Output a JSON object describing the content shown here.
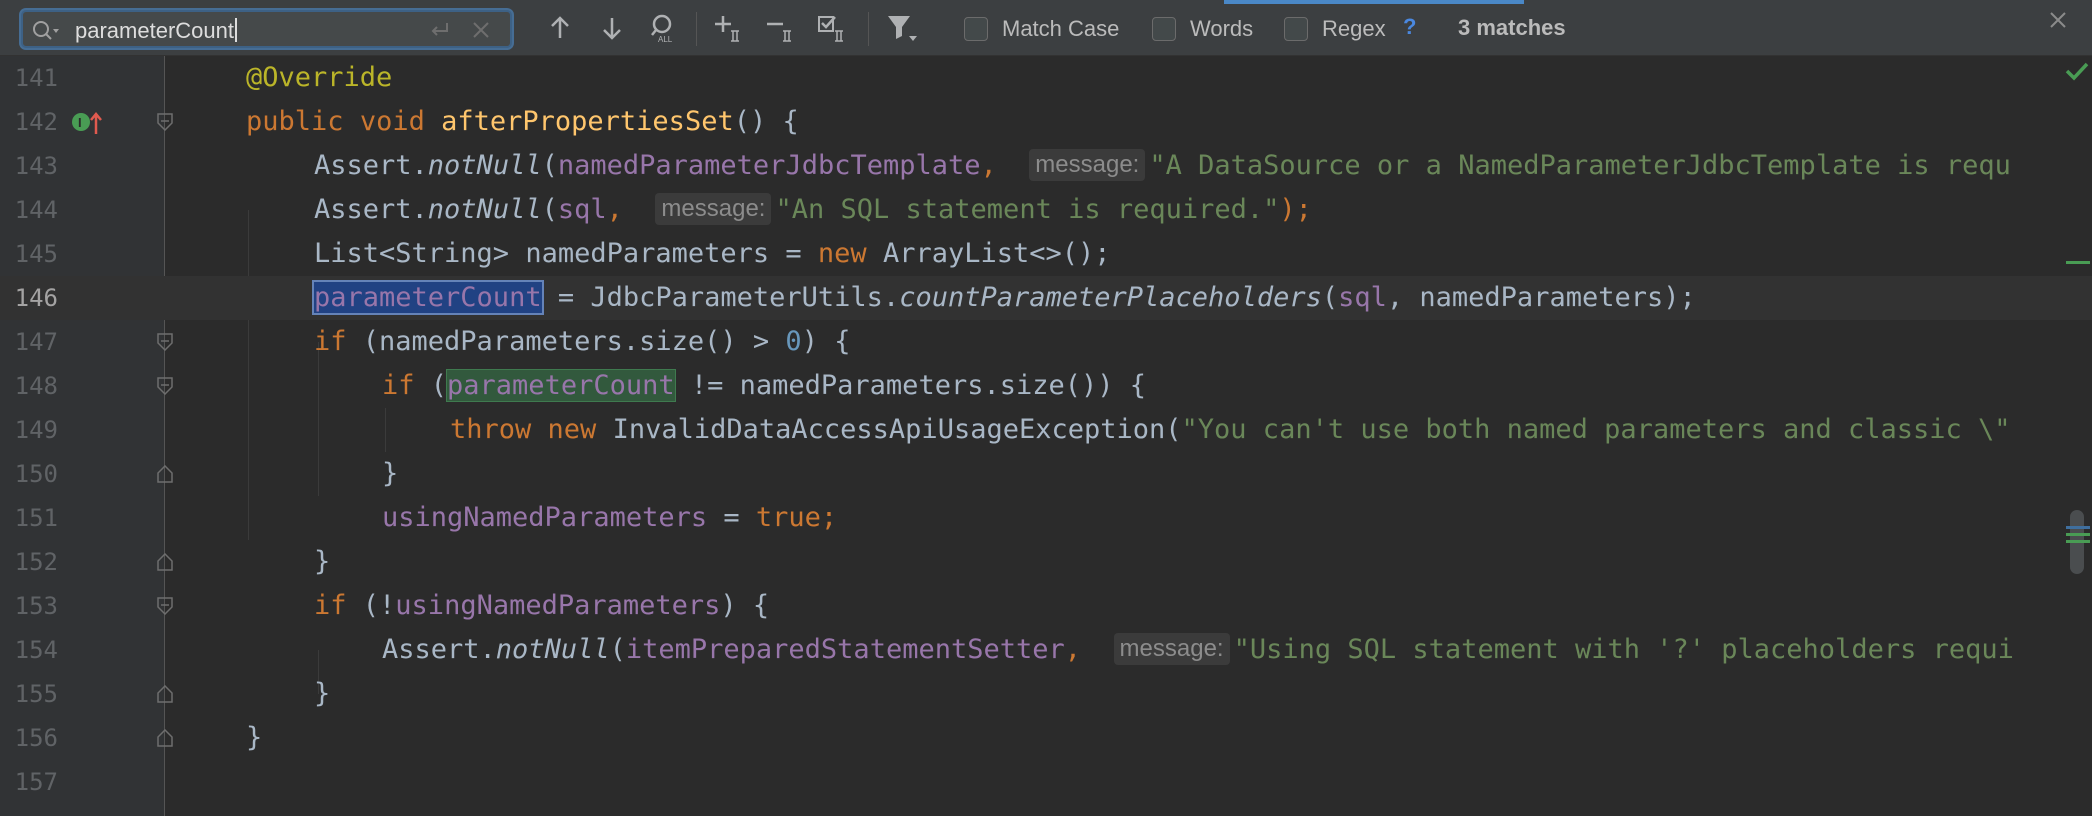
{
  "find": {
    "query": "parameterCount",
    "options": {
      "match_case": "Match Case",
      "words": "Words",
      "regex": "Regex",
      "help": "?"
    },
    "match_count": "3 matches"
  },
  "editor": {
    "lines": [
      {
        "n": "141"
      },
      {
        "n": "142"
      },
      {
        "n": "143"
      },
      {
        "n": "144"
      },
      {
        "n": "145"
      },
      {
        "n": "146"
      },
      {
        "n": "147"
      },
      {
        "n": "148"
      },
      {
        "n": "149"
      },
      {
        "n": "150"
      },
      {
        "n": "151"
      },
      {
        "n": "152"
      },
      {
        "n": "153"
      },
      {
        "n": "154"
      },
      {
        "n": "155"
      },
      {
        "n": "156"
      },
      {
        "n": "157"
      }
    ],
    "tokens": {
      "l141": {
        "annotation": "@Override"
      },
      "l142": {
        "kw1": "public",
        "kw2": "void",
        "fn": "afterPropertiesSet",
        "rest": "() {"
      },
      "l143": {
        "cls": "Assert.",
        "method": "notNull",
        "open": "(",
        "field": "namedParameterJdbcTemplate",
        "comma": ",",
        "hint": "message:",
        "str": "\"A DataSource or a NamedParameterJdbcTemplate is requ"
      },
      "l144": {
        "cls": "Assert.",
        "method": "notNull",
        "open": "(",
        "field": "sql",
        "comma": ",",
        "hint": "message:",
        "str": "\"An SQL statement is required.\"",
        "close": ");"
      },
      "l145": {
        "pre": "List<String> namedParameters = ",
        "kw": "new",
        "post": " ArrayList<>();"
      },
      "l146": {
        "match": "parameterCount",
        "mid": " = JdbcParameterUtils.",
        "method": "countParameterPlaceholders",
        "open": "(",
        "field": "sql",
        "post": ", namedParameters);"
      },
      "l147": {
        "kw": "if",
        "pre": " (namedParameters.size() > ",
        "num": "0",
        "post": ") {"
      },
      "l148": {
        "kw": "if",
        "open": " (",
        "match": "parameterCount",
        "post": " != namedParameters.size()) {"
      },
      "l149": {
        "kw1": "throw",
        "kw2": "new",
        "cls": " InvalidDataAccessApiUsageException(",
        "str": "\"You can't use both named parameters and classic \\\""
      },
      "l150": {
        "brace": "}"
      },
      "l151": {
        "field": "usingNamedParameters",
        "eq": " = ",
        "kw": "true",
        "semi": ";"
      },
      "l152": {
        "brace": "}"
      },
      "l153": {
        "kw": "if",
        "open": " (!",
        "field": "usingNamedParameters",
        "post": ") {"
      },
      "l154": {
        "cls": "Assert.",
        "method": "notNull",
        "open": "(",
        "field": "itemPreparedStatementSetter",
        "comma": ",",
        "hint": "message:",
        "str": "\"Using SQL statement with '?' placeholders requi"
      },
      "l155": {
        "brace": "}"
      },
      "l156": {
        "brace": "}"
      }
    }
  },
  "colors": {
    "keyword": "#cc7832",
    "method": "#ffc66d",
    "field": "#9876aa",
    "string": "#6a8759",
    "number": "#6897bb",
    "annotation": "#bbb529",
    "default": "#a9b7c6"
  }
}
